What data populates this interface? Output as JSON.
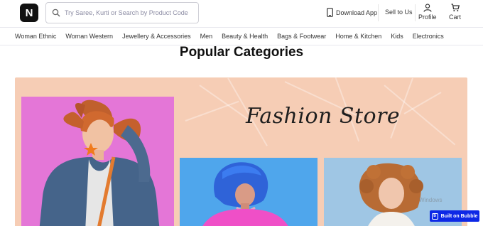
{
  "header": {
    "logo_letter": "N",
    "search_placeholder": "Try Saree, Kurti or Search by Product Code",
    "download_app": "Download App",
    "sell_to_us": "Sell to Us",
    "profile": "Profile",
    "cart": "Cart"
  },
  "nav": {
    "items": [
      "Woman Ethnic",
      "Woman Western",
      "Jewellery & Accessories",
      "Men",
      "Beauty & Health",
      "Bags & Footwear",
      "Home & Kitchen",
      "Kids",
      "Electronics"
    ]
  },
  "section": {
    "title": "Popular Categories"
  },
  "banner": {
    "script_text": "Fashion Store"
  },
  "badge": {
    "label": "Built on Bubble"
  },
  "watermark": {
    "text": "Windows"
  },
  "colors": {
    "banner_bg": "#f6cdb5",
    "badge_bg": "#0d28e6",
    "photo_main_bg": "#e476d7",
    "photo_blue_bg": "#4fa6ec"
  },
  "icons": [
    "search-icon",
    "phone-icon",
    "profile-icon",
    "cart-icon",
    "bubble-icon"
  ]
}
